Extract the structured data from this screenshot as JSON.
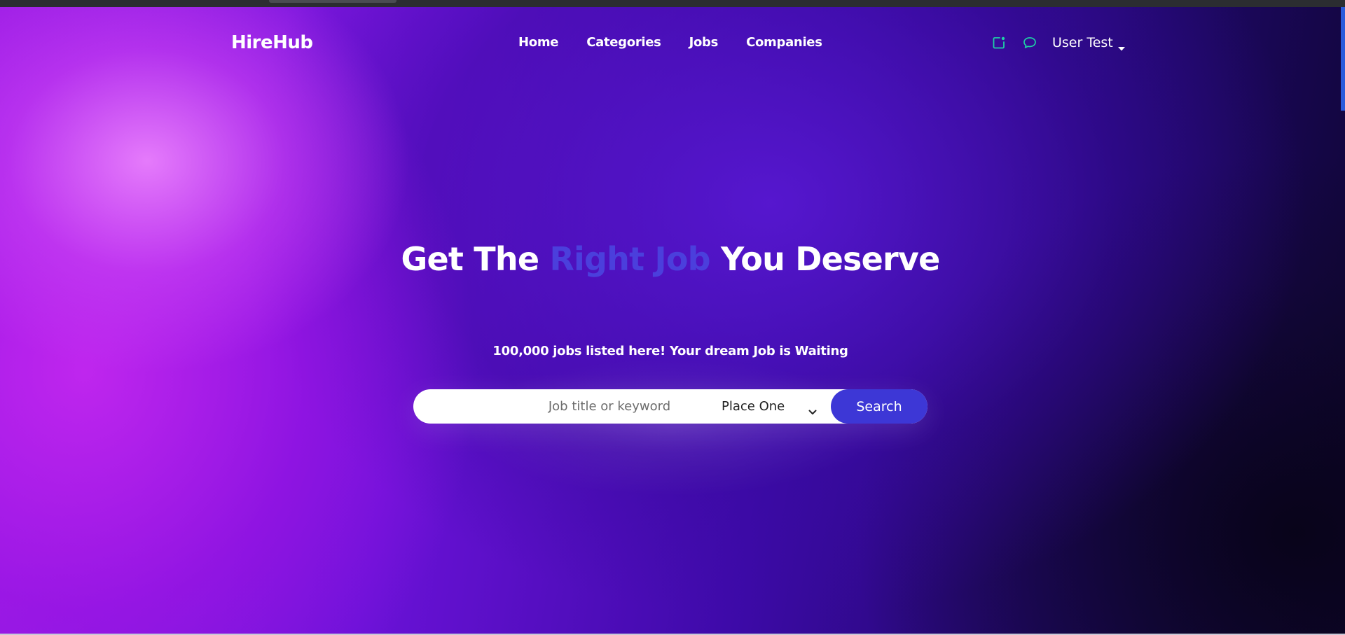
{
  "navbar": {
    "brand": "HireHub",
    "links": [
      "Home",
      "Categories",
      "Jobs",
      "Companies"
    ],
    "icons": [
      "new-post-icon",
      "chat-icon"
    ],
    "user_name": "User Test"
  },
  "hero": {
    "headline_before": "Get The ",
    "headline_accent": "Right Job",
    "headline_after": " You Deserve",
    "subtitle": "100,000 jobs listed here! Your dream Job is Waiting"
  },
  "search": {
    "placeholder": "Job title or keyword",
    "place_selected": "Place One",
    "button_label": "Search"
  },
  "colors": {
    "accent": "#3d37d6",
    "headline_accent": "#4b3fdc",
    "icon_teal": "#1fd1a6"
  }
}
